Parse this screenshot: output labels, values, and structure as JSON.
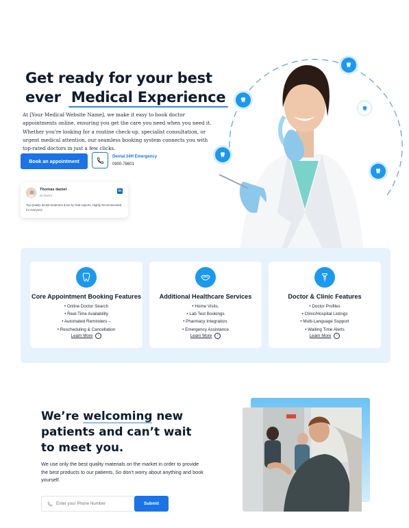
{
  "hero": {
    "title_line1": "Get ready for your best",
    "title_line2_prefix": "ever",
    "title_accent": "Medical Experience",
    "description": "At [Your Medical Website Name], we make it easy to book doctor appointments online, ensuring you get the care you need when you need it. Whether you're looking for a routine check-up, specialist consultation, or urgent medical attention, our seamless booking system connects you with top-rated doctors in just a few clicks.",
    "cta_label": "Book an appointment",
    "emergency_label": "Dental 24H Emergency",
    "emergency_phone": "0900-78601"
  },
  "review": {
    "name": "Thomas daniel",
    "role": "Dr.Doctor",
    "linkedin_icon": "in",
    "text": "Top Quality dental treatment done by field experts, Highly Recommended for everyone"
  },
  "features": [
    {
      "icon": "tooth-icon",
      "title": "Core Appointment Booking Features",
      "items": [
        "Online Doctor Search",
        "Real-Time Availability",
        "Automated Reminders –",
        "Rescheduling & Cancellation"
      ],
      "link": "Learn More"
    },
    {
      "icon": "mouth-icon",
      "title": "Additional Healthcare Services",
      "items": [
        "Home Visits.",
        "Lab Test Bookings",
        "Pharmacy Integration.",
        "Emergency Assistance"
      ],
      "link": "Learn More"
    },
    {
      "icon": "implant-icon",
      "title": "Doctor & Clinic Features",
      "items": [
        "Doctor Profiles",
        "Clinic/Hospital Listings",
        "Multi-Language Support",
        "Waiting Time Alerts"
      ],
      "link": "Learn More"
    }
  ],
  "welcome": {
    "title_a": "We’re ",
    "title_u": "welcoming",
    "title_b": " new patients and can’t wait to meet you.",
    "description": "We use only the best quality materials on the market in order to provide the best products to our patients, So don’t worry about anything and book yourself.",
    "phone_placeholder": "Enter your Phone Number",
    "submit_label": "Submit"
  },
  "colors": {
    "primary": "#1b73e8",
    "accent": "#1a99f0",
    "panel": "#e6f3fc"
  }
}
